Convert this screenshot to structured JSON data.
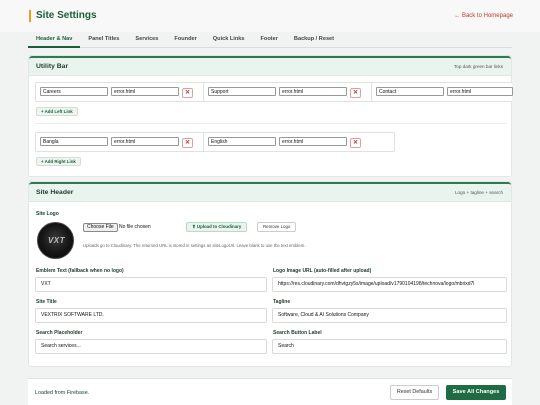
{
  "header": {
    "title": "Site Settings",
    "back_link": "← Back to Homepage"
  },
  "tabs": [
    "Header & Nav",
    "Panel Titles",
    "Services",
    "Founder",
    "Quick Links",
    "Footer",
    "Backup / Reset"
  ],
  "utility_bar": {
    "title": "Utility Bar",
    "hint": "Top dark green bar links",
    "left_links": [
      {
        "label": "Careers",
        "url": "error.html"
      },
      {
        "label": "Support",
        "url": "error.html"
      },
      {
        "label": "Contact",
        "url": "error.html"
      }
    ],
    "add_left_label": "+ Add Left Link",
    "right_links": [
      {
        "label": "Bangla",
        "url": "error.html"
      },
      {
        "label": "English",
        "url": "error.html"
      }
    ],
    "add_right_label": "+ Add Right Link",
    "remove_symbol": "✕"
  },
  "site_header": {
    "title": "Site Header",
    "hint": "Logo + tagline + search",
    "logo_label": "Site Logo",
    "logo_text": "VXT",
    "choose_file_label": "Choose File",
    "no_file_text": "No file chosen",
    "upload_label": "⬆ Upload to Cloudinary",
    "remove_logo_label": "Remove Logo",
    "upload_help": "Uploads go to Cloudinary. The returned URL is stored in settings as siteLogoUrl. Leave blank to use the text emblem.",
    "emblem_label": "Emblem Text (fallback when no logo)",
    "emblem_value": "VXT",
    "logo_url_label": "Logo Image URL (auto-filled after upload)",
    "logo_url_value": "https://res.cloudinary.com/dhvtgzy5s/image/upload/v1790104198/technova/logo/mbrixd7l",
    "site_title_label": "Site Title",
    "site_title_value": "VEXTRIX SOFTWARE LTD.",
    "tagline_label": "Tagline",
    "tagline_value": "Software, Cloud & AI Solutions Company",
    "search_placeholder_label": "Search Placeholder",
    "search_placeholder_value": "Search services...",
    "search_button_label": "Search Button Label",
    "search_button_value": "Search"
  },
  "footer_bar": {
    "status": "Loaded from Firebase.",
    "reset_label": "Reset Defaults",
    "save_label": "Save All Changes"
  },
  "colors": {
    "brand": "#1f6b43",
    "accent": "#e6a21a",
    "danger": "#c0392b"
  }
}
